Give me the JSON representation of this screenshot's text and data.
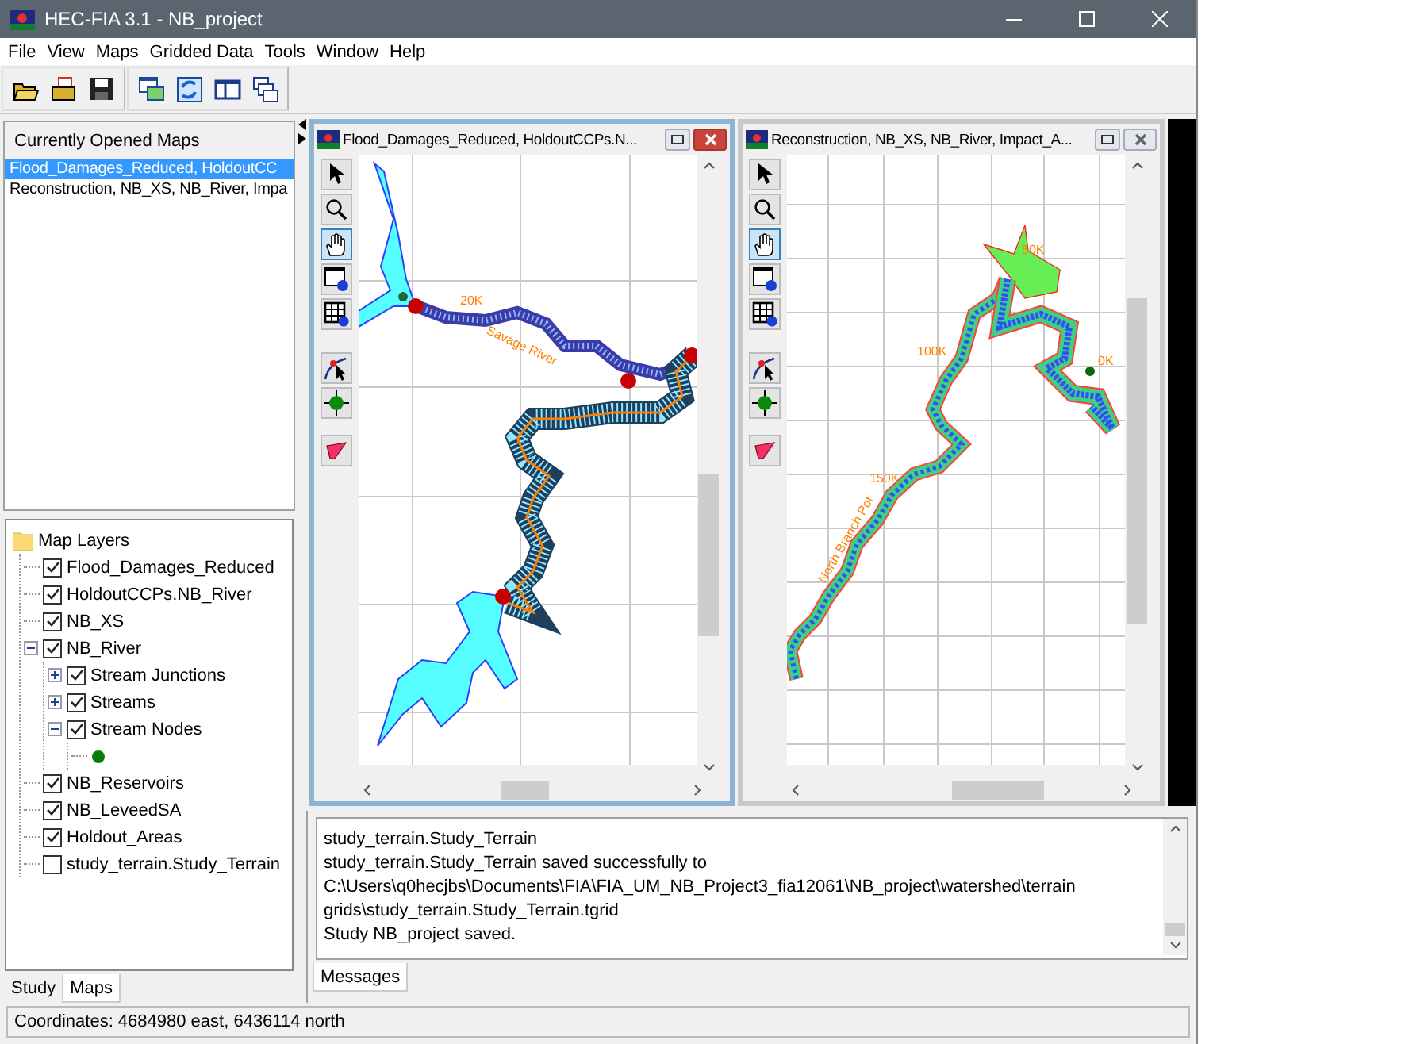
{
  "window": {
    "title": "HEC-FIA 3.1 - NB_project"
  },
  "menu": [
    "File",
    "View",
    "Maps",
    "Gridded Data",
    "Tools",
    "Window",
    "Help"
  ],
  "opened_maps": {
    "title": "Currently Opened Maps",
    "items": [
      {
        "label": "Flood_Damages_Reduced, HoldoutCC",
        "selected": true
      },
      {
        "label": "Reconstruction, NB_XS, NB_River, Impa",
        "selected": false
      }
    ]
  },
  "map_layers": {
    "label": "Map Layers",
    "children": [
      {
        "label": "Flood_Damages_Reduced",
        "checked": true
      },
      {
        "label": "HoldoutCCPs.NB_River",
        "checked": true
      },
      {
        "label": "NB_XS",
        "checked": true
      },
      {
        "label": "NB_River",
        "checked": true,
        "expanded": true,
        "children": [
          {
            "label": "Stream Junctions",
            "checked": true,
            "expanded": false
          },
          {
            "label": "Streams",
            "checked": true,
            "expanded": false
          },
          {
            "label": "Stream Nodes",
            "checked": true,
            "expanded": true,
            "children": [
              {
                "kind": "symbol",
                "color": "#0a7a0a"
              }
            ]
          }
        ]
      },
      {
        "label": "NB_Reservoirs",
        "checked": true
      },
      {
        "label": "NB_LeveedSA",
        "checked": true
      },
      {
        "label": "Holdout_Areas",
        "checked": true
      },
      {
        "label": "study_terrain.Study_Terrain",
        "checked": false
      }
    ]
  },
  "left_tabs": [
    {
      "label": "Study",
      "selected": false
    },
    {
      "label": "Maps",
      "selected": true
    }
  ],
  "map_windows": [
    {
      "title": "Flood_Damages_Reduced, HoldoutCCPs.N...",
      "active": true,
      "kind": "reduced",
      "tools": [
        {
          "kind": "pointer",
          "selected": false
        },
        {
          "kind": "zoom",
          "selected": false
        },
        {
          "kind": "pan",
          "selected": true
        },
        {
          "kind": "info",
          "selected": false
        },
        {
          "kind": "grid-info",
          "selected": false
        },
        {
          "kind": "select-node",
          "selected": false
        },
        {
          "kind": "target",
          "selected": false
        },
        {
          "kind": "area",
          "selected": false
        }
      ],
      "labels": [
        "20K",
        "Savage River"
      ]
    },
    {
      "title": "Reconstruction, NB_XS, NB_River, Impact_A...",
      "active": false,
      "kind": "reconstruction",
      "tools": [
        {
          "kind": "pointer",
          "selected": false
        },
        {
          "kind": "zoom",
          "selected": false
        },
        {
          "kind": "pan",
          "selected": true
        },
        {
          "kind": "info",
          "selected": false
        },
        {
          "kind": "grid-info",
          "selected": false
        },
        {
          "kind": "select-node",
          "selected": false
        },
        {
          "kind": "target",
          "selected": false
        },
        {
          "kind": "area",
          "selected": false
        }
      ],
      "labels": [
        "50K",
        "100K",
        "150K",
        "0K",
        "North Branch Pot"
      ]
    }
  ],
  "messages": {
    "lines": [
      "study_terrain.Study_Terrain",
      "study_terrain.Study_Terrain saved successfully to",
      "C:\\Users\\q0hecjbs\\Documents\\FIA\\FIA_UM_NB_Project3_fia12061\\NB_project\\watershed\\terrain",
      "grids\\study_terrain.Study_Terrain.tgrid",
      "Study NB_project saved."
    ],
    "tabs": [
      {
        "label": "Messages",
        "selected": true
      }
    ]
  },
  "status_bar": "Coordinates: 4684980 east, 6436114 north"
}
